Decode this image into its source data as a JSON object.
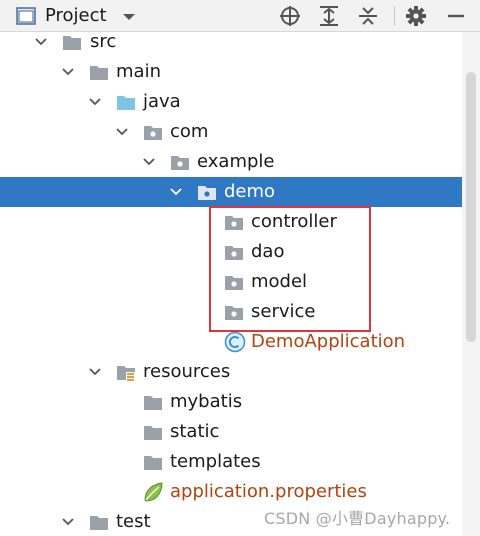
{
  "header": {
    "title": "Project",
    "icons": [
      "project-window-icon",
      "chevron-down-icon",
      "locate-icon",
      "expand-all-icon",
      "collapse-all-icon",
      "gear-icon",
      "hide-icon"
    ]
  },
  "tree": {
    "src": "src",
    "main": "main",
    "java": "java",
    "com": "com",
    "example": "example",
    "demo": "demo",
    "controller": "controller",
    "dao": "dao",
    "model": "model",
    "service": "service",
    "demo_application": "DemoApplication",
    "resources": "resources",
    "mybatis": "mybatis",
    "static": "static",
    "templates": "templates",
    "application_properties": "application.properties",
    "test": "test"
  },
  "watermark": "CSDN @小曹Dayhappy.",
  "colors": {
    "selection": "#2f78c4",
    "highlight_border": "#e0333b",
    "java_source_folder": "#7fc4e6",
    "class_file_text": "#b5410f"
  }
}
